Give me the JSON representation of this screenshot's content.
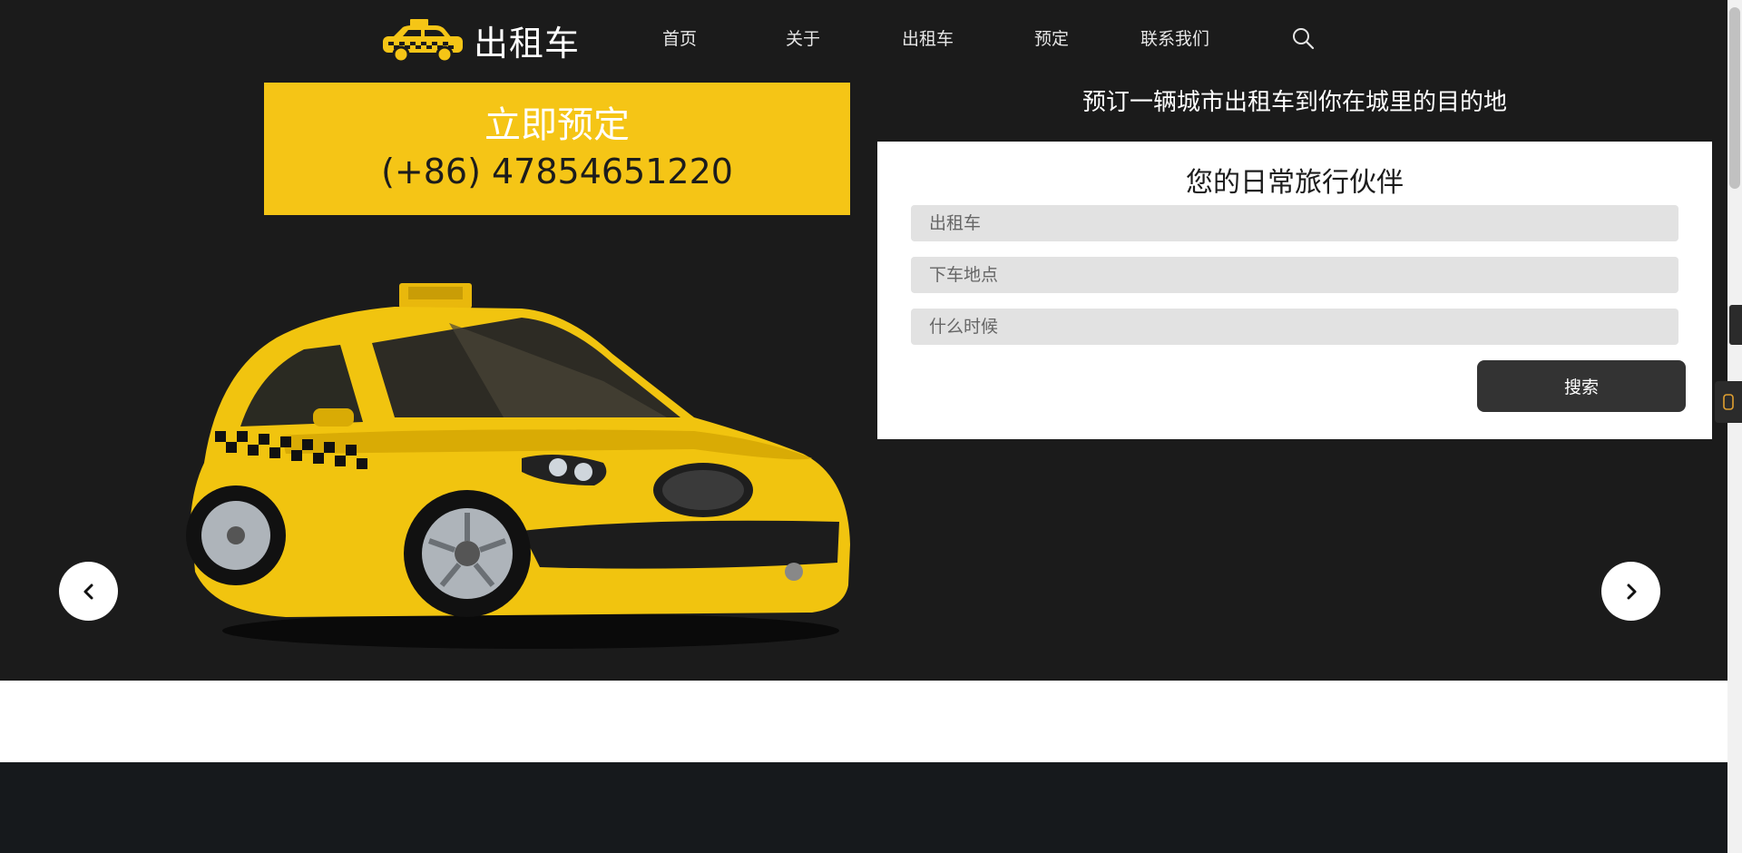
{
  "brand": {
    "name": "出租车",
    "icon": "taxi-icon"
  },
  "nav": {
    "items": [
      {
        "label": "首页"
      },
      {
        "label": "关于"
      },
      {
        "label": "出租车"
      },
      {
        "label": "预定"
      },
      {
        "label": "联系我们"
      }
    ],
    "search_icon": "search-icon"
  },
  "cta": {
    "title": "立即预定",
    "phone": "(+86) 47854651220"
  },
  "booking": {
    "tagline": "预订一辆城市出租车到你在城里的目的地",
    "title": "您的日常旅行伙伴",
    "fields": [
      {
        "placeholder": "出租车"
      },
      {
        "placeholder": "下车地点"
      },
      {
        "placeholder": "什么时候"
      }
    ],
    "search_label": "搜索"
  },
  "carousel": {
    "prev_icon": "chevron-left-icon",
    "next_icon": "chevron-right-icon"
  },
  "colors": {
    "accent": "#f5c516",
    "hero_bg": "#1b1b1b",
    "button": "#333333",
    "footer": "#16191c"
  }
}
